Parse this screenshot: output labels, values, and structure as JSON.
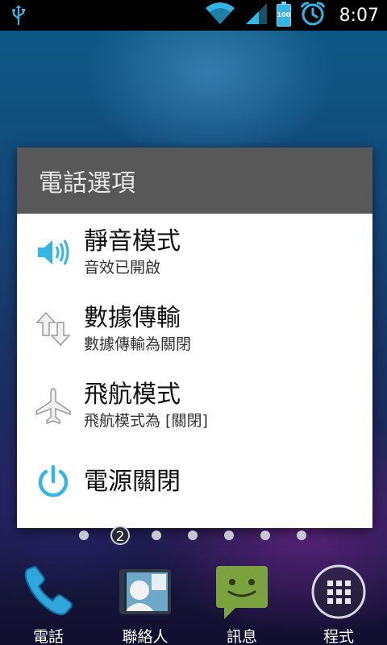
{
  "status": {
    "time": "8:07",
    "battery_level": "100",
    "icons": [
      "usb-icon",
      "wifi-icon",
      "signal-icon",
      "battery-icon",
      "alarm-icon"
    ]
  },
  "dialog": {
    "title": "電話選項",
    "options": [
      {
        "label": "靜音模式",
        "sub": "音效已開啟",
        "icon": "speaker-icon"
      },
      {
        "label": "數據傳輸",
        "sub": "數據傳輸為關閉",
        "icon": "data-transfer-icon"
      },
      {
        "label": "飛航模式",
        "sub": "飛航模式為 [關閉]",
        "icon": "airplane-icon"
      },
      {
        "label": "電源關閉",
        "icon": "power-icon"
      }
    ]
  },
  "pager": {
    "current_page": "2"
  },
  "dock": [
    {
      "label": "電話",
      "icon": "phone-icon"
    },
    {
      "label": "聯絡人",
      "icon": "contacts-icon"
    },
    {
      "label": "訊息",
      "icon": "messaging-icon"
    },
    {
      "label": "程式",
      "icon": "apps-icon"
    }
  ],
  "colors": {
    "accent": "#33b5e5",
    "dialog_title_bg": "#585858",
    "messaging_green": "#7ba23f"
  }
}
